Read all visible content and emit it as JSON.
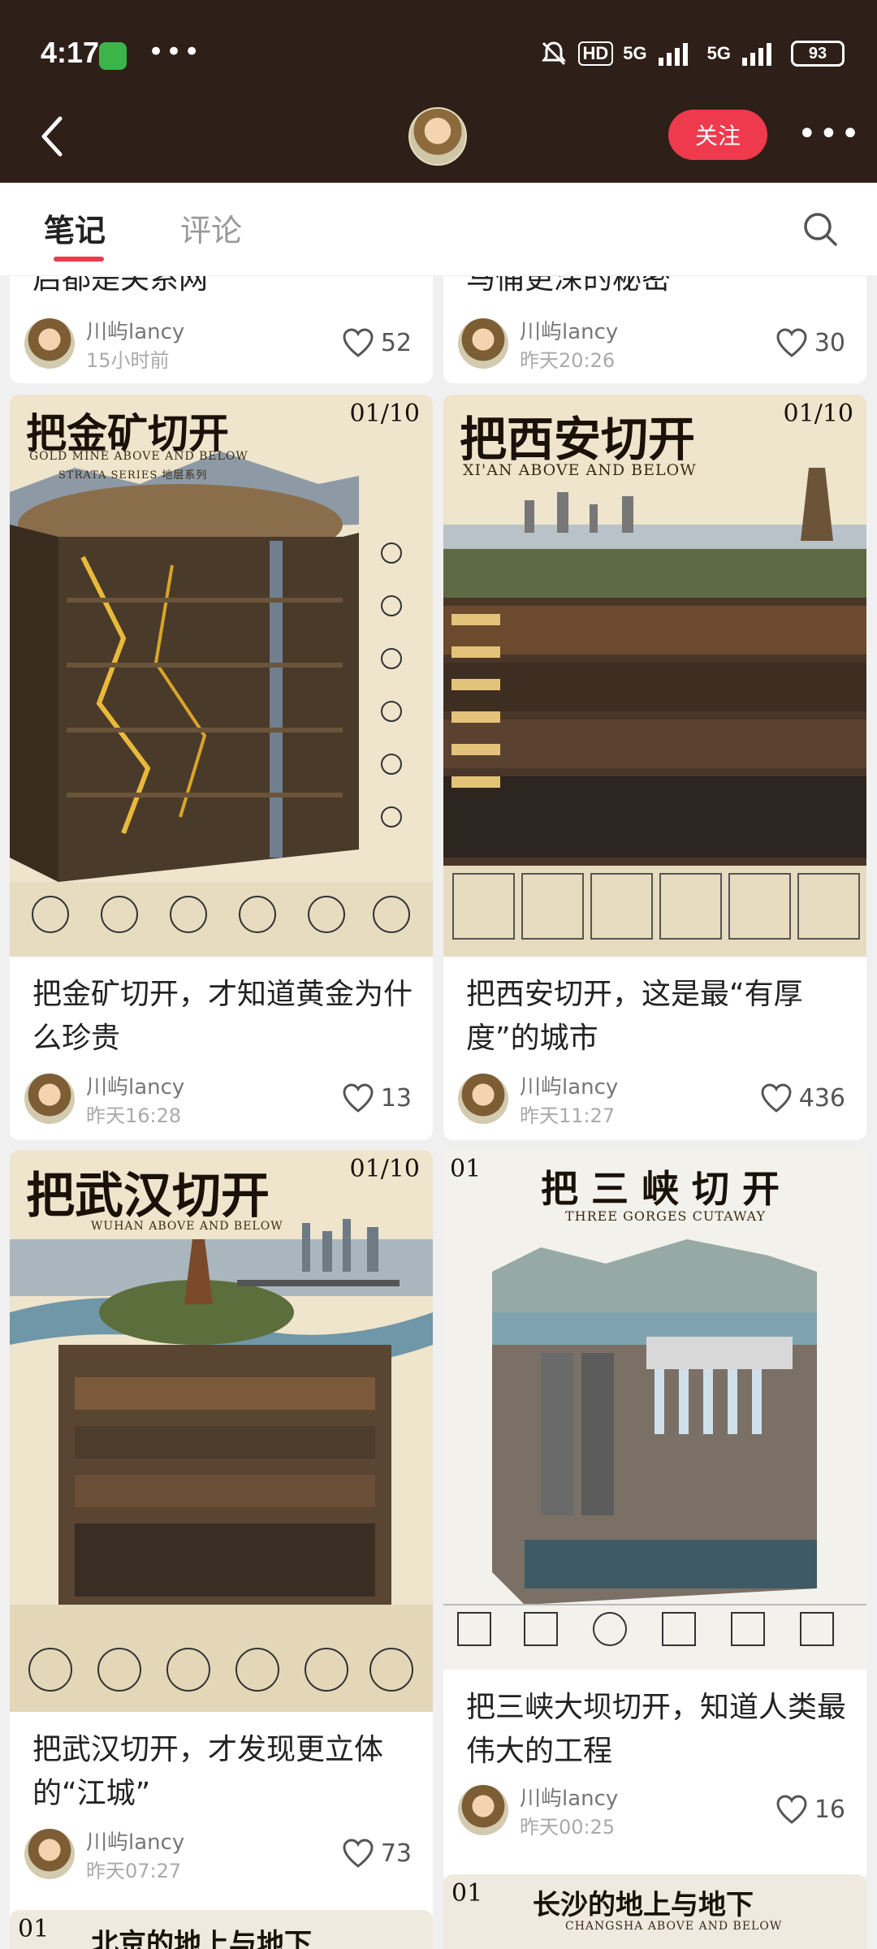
{
  "status": {
    "time": "4:17",
    "hd": "HD",
    "sig1": "5G",
    "sig2": "5G",
    "battery": "93"
  },
  "header": {
    "follow_label": "关注"
  },
  "tabs": {
    "notes": "笔记",
    "comments": "评论"
  },
  "author": "川屿lancy",
  "top_cards": [
    {
      "partial_title": "启都是关系网",
      "time": "15小时前",
      "likes": "52"
    },
    {
      "partial_title": "马俑更深的秘密",
      "time": "昨天20:26",
      "likes": "30"
    }
  ],
  "cards": [
    {
      "title": "把金矿切开，才知道黄金为什么珍贵",
      "time": "昨天16:28",
      "likes": "13",
      "poster": {
        "title": "把金矿切开",
        "subtitle": "GOLD MINE ABOVE AND BELOW",
        "series": "STRATA SERIES 地层系列",
        "num": "01/10"
      }
    },
    {
      "title": "把西安切开，这是最“有厚度”的城市",
      "time": "昨天11:27",
      "likes": "436",
      "poster": {
        "title": "把西安切开",
        "subtitle": "XI'AN ABOVE AND BELOW",
        "num": "01/10"
      }
    },
    {
      "title": "把武汉切开，才发现更立体的“江城”",
      "time": "昨天07:27",
      "likes": "73",
      "poster": {
        "title": "把武汉切开",
        "subtitle": "WUHAN ABOVE AND BELOW",
        "num": "01/10"
      }
    },
    {
      "title": "把三峡大坝切开，知道人类最伟大的工程",
      "time": "昨天00:25",
      "likes": "16",
      "poster": {
        "title": "把 三 峡 切 开",
        "subtitle": "THREE GORGES CUTAWAY",
        "num": "01"
      }
    }
  ],
  "bottom_cards": [
    {
      "poster_title": "北京的地上与地下",
      "num": "01"
    },
    {
      "poster_title": "长沙的地上与地下",
      "subtitle": "CHANGSHA ABOVE AND BELOW",
      "num": "01"
    }
  ]
}
